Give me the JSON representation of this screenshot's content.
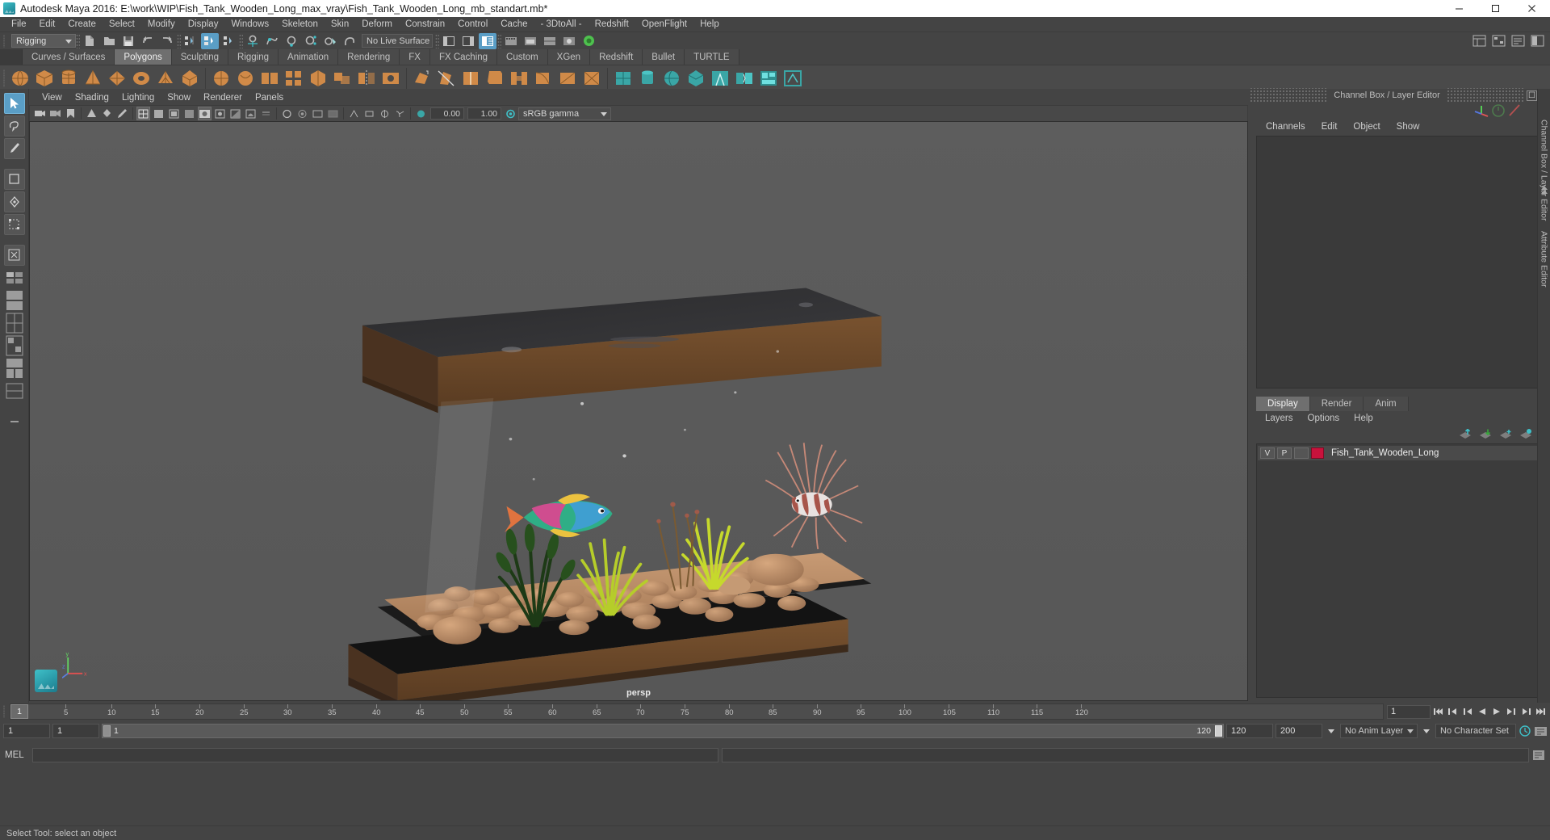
{
  "titlebar": {
    "title": "Autodesk Maya 2016: E:\\work\\WIP\\Fish_Tank_Wooden_Long_max_vray\\Fish_Tank_Wooden_Long_mb_standart.mb*",
    "minimize": "—",
    "maximize": "❐",
    "close": "✕"
  },
  "menubar": {
    "items": [
      {
        "label": "File"
      },
      {
        "label": "Edit"
      },
      {
        "label": "Create"
      },
      {
        "label": "Select"
      },
      {
        "label": "Modify"
      },
      {
        "label": "Display"
      },
      {
        "label": "Windows"
      },
      {
        "label": "Skeleton"
      },
      {
        "label": "Skin"
      },
      {
        "label": "Deform"
      },
      {
        "label": "Constrain"
      },
      {
        "label": "Control"
      },
      {
        "label": "Cache"
      },
      {
        "label": "- 3DtoAll -"
      },
      {
        "label": "Redshift"
      },
      {
        "label": "OpenFlight"
      },
      {
        "label": "Help"
      }
    ]
  },
  "toolbar": {
    "menuset": "Rigging",
    "live_surface": "No Live Surface"
  },
  "shelf": {
    "tabs": [
      {
        "label": "Curves / Surfaces",
        "selected": false
      },
      {
        "label": "Polygons",
        "selected": true
      },
      {
        "label": "Sculpting",
        "selected": false
      },
      {
        "label": "Rigging",
        "selected": false
      },
      {
        "label": "Animation",
        "selected": false
      },
      {
        "label": "Rendering",
        "selected": false
      },
      {
        "label": "FX",
        "selected": false
      },
      {
        "label": "FX Caching",
        "selected": false
      },
      {
        "label": "Custom",
        "selected": false
      },
      {
        "label": "XGen",
        "selected": false
      },
      {
        "label": "Redshift",
        "selected": false
      },
      {
        "label": "Bullet",
        "selected": false
      },
      {
        "label": "TURTLE",
        "selected": false
      }
    ]
  },
  "viewport": {
    "menu": [
      "View",
      "Shading",
      "Lighting",
      "Show",
      "Renderer",
      "Panels"
    ],
    "exposure": "0.00",
    "gamma": "1.00",
    "color_space": "sRGB gamma",
    "camera_label": "persp",
    "axis": {
      "x": "x",
      "y": "y",
      "z": "z"
    }
  },
  "channel_box": {
    "panel_title": "Channel Box / Layer Editor",
    "tabs": [
      "Channels",
      "Edit",
      "Object",
      "Show"
    ],
    "vertical_tabs": [
      "Channel Box / Layer Editor",
      "Attribute Editor"
    ]
  },
  "layer_editor": {
    "tabs": [
      {
        "label": "Display",
        "selected": true
      },
      {
        "label": "Render",
        "selected": false
      },
      {
        "label": "Anim",
        "selected": false
      }
    ],
    "menu": [
      "Layers",
      "Options",
      "Help"
    ],
    "layers": [
      {
        "visibility": "V",
        "playback": "P",
        "color": "#c9123c",
        "name": "Fish_Tank_Wooden_Long"
      }
    ]
  },
  "timeline": {
    "current_frame": "1",
    "ticks": [
      "5",
      "10",
      "15",
      "20",
      "25",
      "30",
      "35",
      "40",
      "45",
      "50",
      "55",
      "60",
      "65",
      "70",
      "75",
      "80",
      "85",
      "90",
      "95",
      "100",
      "105",
      "110",
      "115",
      "120"
    ],
    "frame_field": "1",
    "range_start": "1",
    "range_min": "1",
    "range_bar_start": "1",
    "range_bar_end": "120",
    "range_end": "120",
    "playback_end": "200",
    "anim_layer": "No Anim Layer",
    "character_set": "No Character Set"
  },
  "command_line": {
    "language": "MEL",
    "value": "",
    "placeholder": ""
  },
  "status_bar": {
    "message": "Select Tool: select an object"
  },
  "colors": {
    "accent_blue": "#5a9ec6",
    "accent_teal": "#3aa6a6",
    "shelf_orange": "#d08a48",
    "layer_red": "#c9123c",
    "viewport_bg": "#5a5a5a"
  }
}
